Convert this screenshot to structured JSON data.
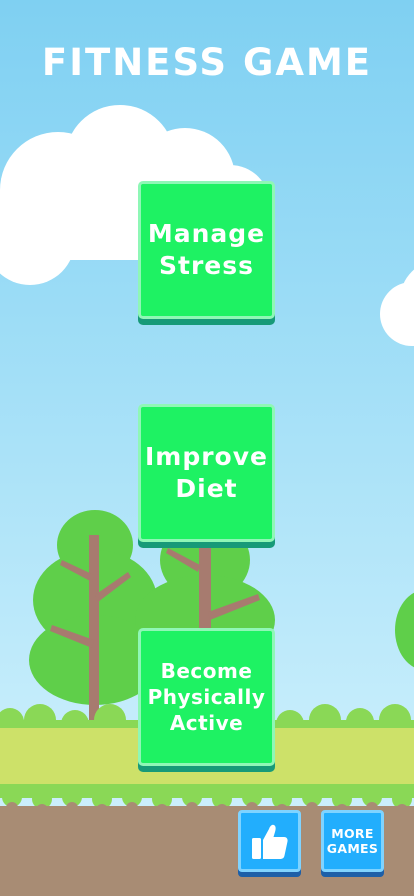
{
  "title": "FITNESS GAME",
  "menu": {
    "buttons": [
      {
        "label": "Manage\nStress"
      },
      {
        "label": "Improve\nDiet"
      },
      {
        "label": "Become\nPhysically\nActive"
      }
    ]
  },
  "footer": {
    "like_icon": "thumbs-up-icon",
    "more_games_label": "MORE\nGAMES"
  },
  "colors": {
    "sky": "#9bdcf6",
    "menu_button": "#1ef263",
    "menu_button_shadow": "#179a78",
    "footer_button": "#22aefd",
    "grass": "#b6e062",
    "ground": "#a88c74"
  }
}
